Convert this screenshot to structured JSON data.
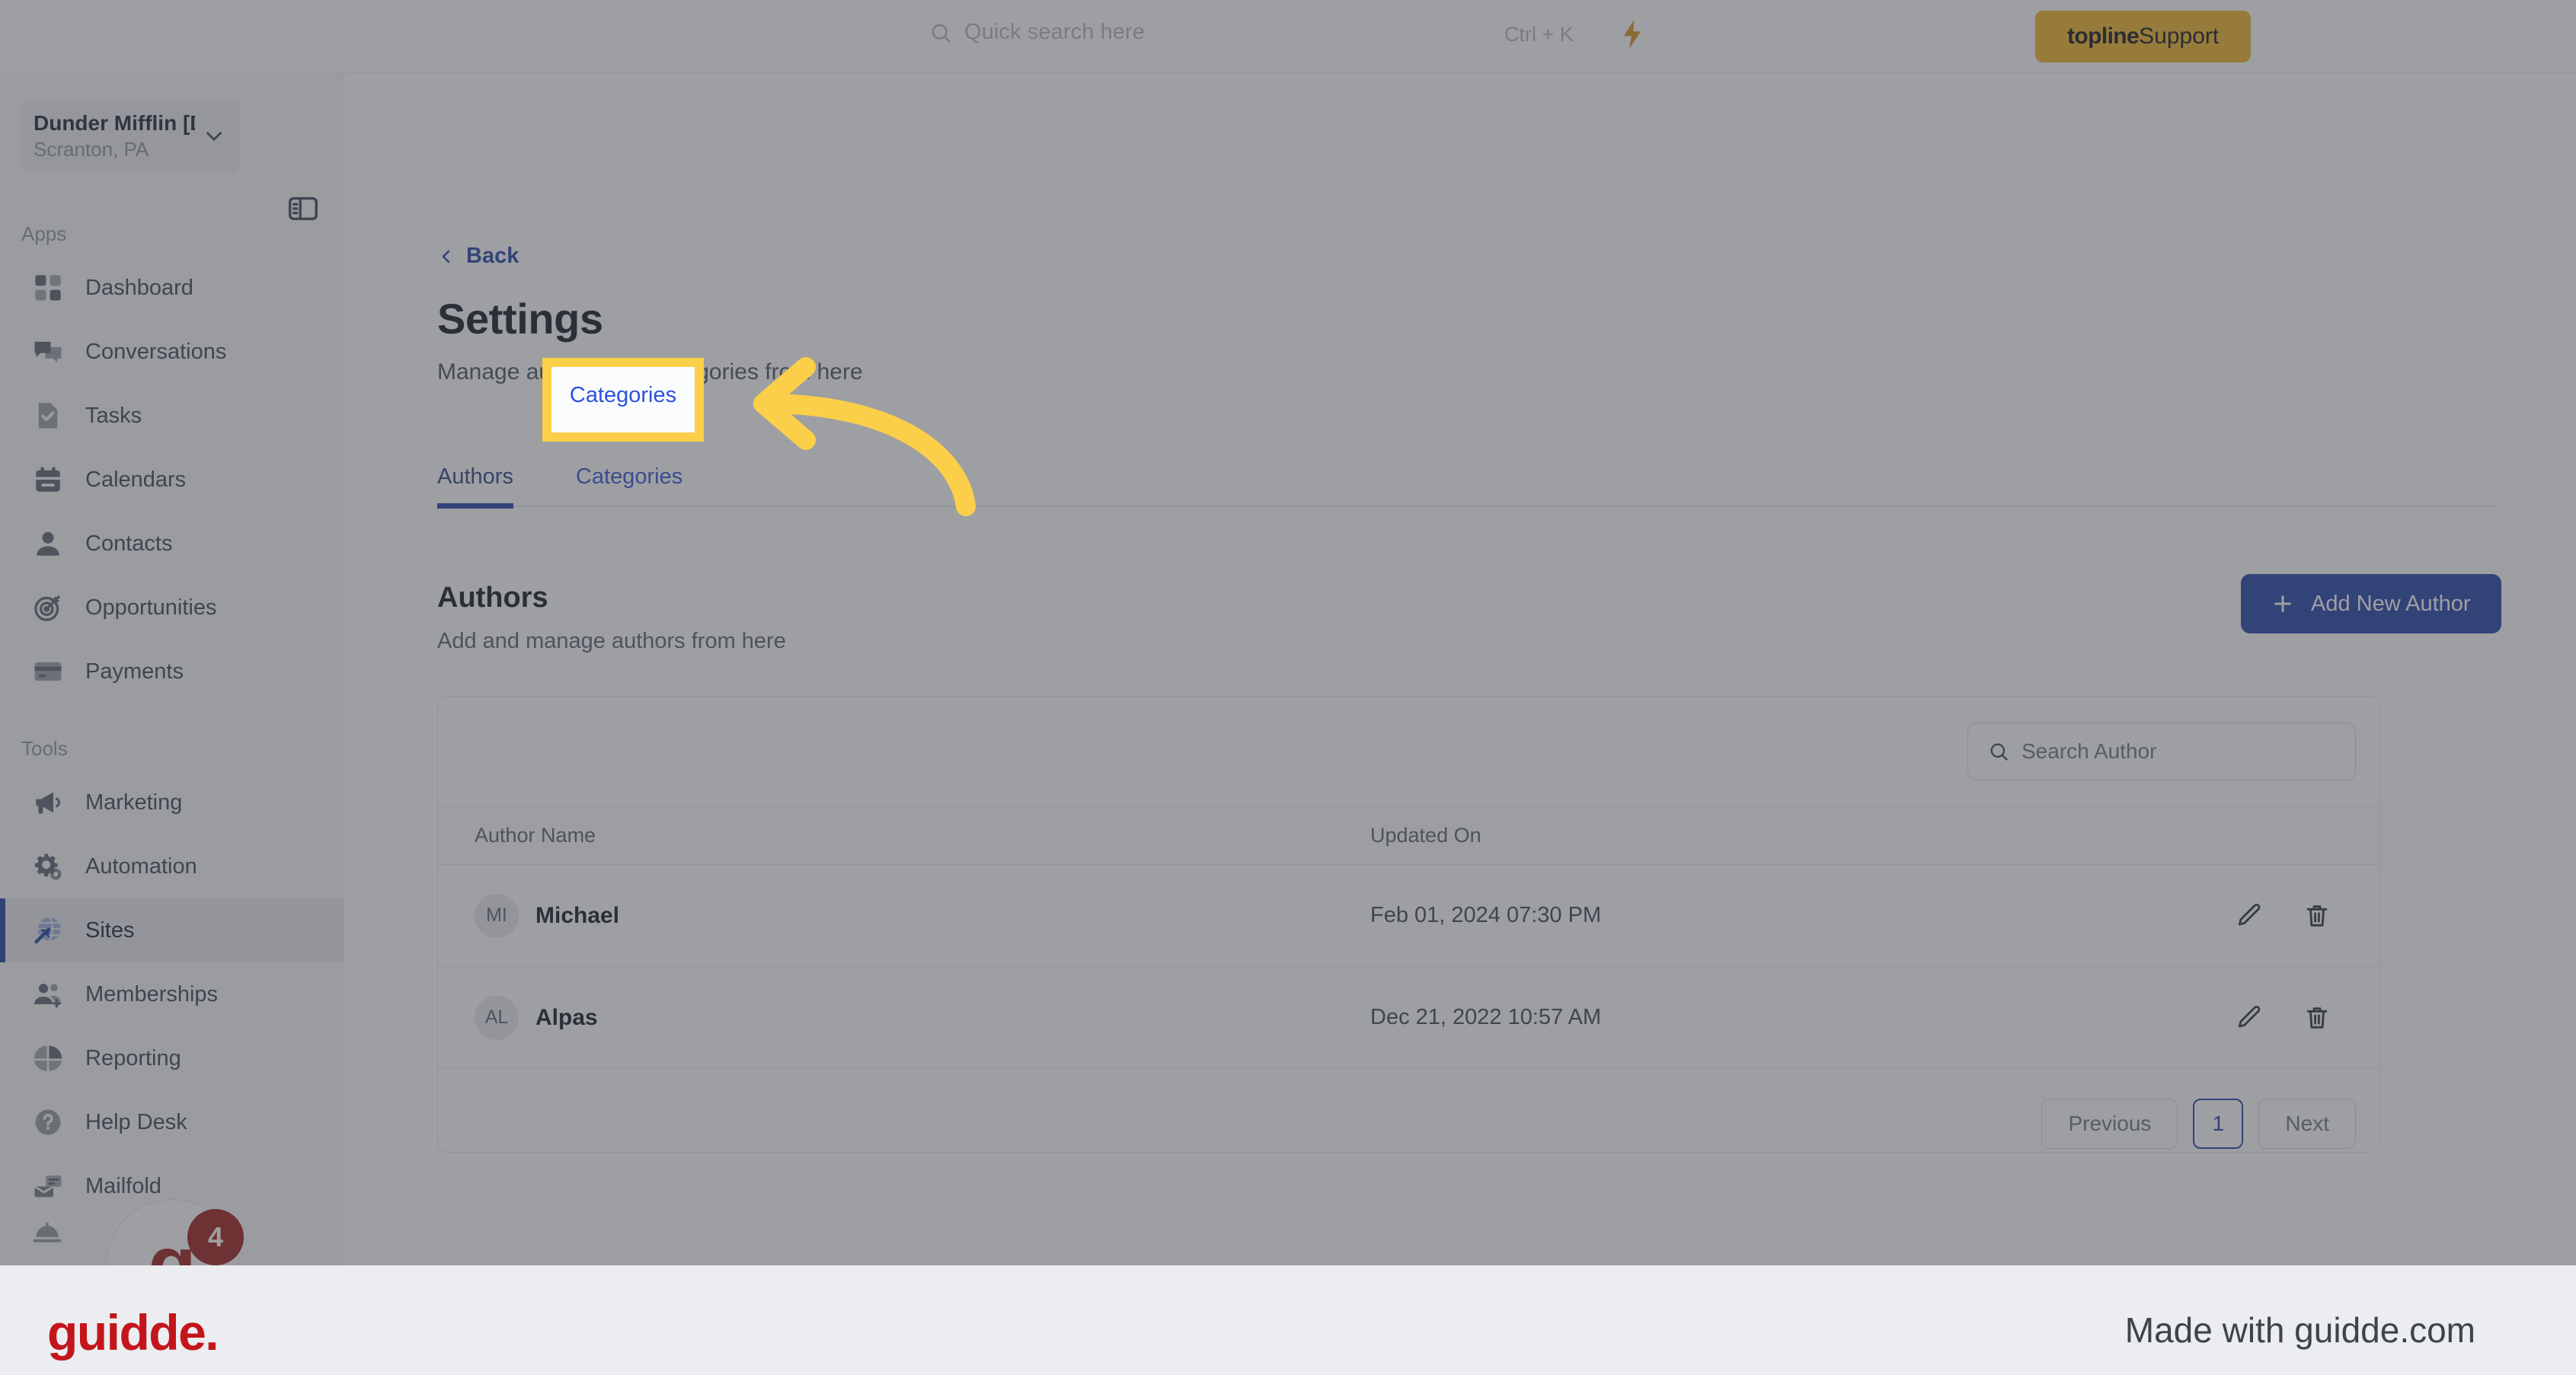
{
  "topbar": {
    "search_placeholder": "Quick search here",
    "search_shortcut": "Ctrl + K",
    "bolt_icon": "lightning-bolt-icon",
    "search_icon": "search-icon",
    "support_brand": "topline",
    "support_word": " Support",
    "support_bg": "#f0b429"
  },
  "sidebar": {
    "org_name": "Dunder Mifflin [D...",
    "org_location": "Scranton, PA",
    "chevron_icon": "chevron-down-icon",
    "panel_toggle_icon": "sidebar-toggle-icon",
    "bell_icon": "service-bell-icon",
    "sections": [
      {
        "label": "Apps",
        "items": [
          {
            "label": "Dashboard",
            "icon": "dashboard-icon",
            "active": false
          },
          {
            "label": "Conversations",
            "icon": "chat-bubbles-icon",
            "active": false
          },
          {
            "label": "Tasks",
            "icon": "task-check-icon",
            "active": false
          },
          {
            "label": "Calendars",
            "icon": "calendar-icon",
            "active": false
          },
          {
            "label": "Contacts",
            "icon": "person-icon",
            "active": false
          },
          {
            "label": "Opportunities",
            "icon": "target-icon",
            "active": false
          },
          {
            "label": "Payments",
            "icon": "credit-card-icon",
            "active": false
          }
        ]
      },
      {
        "label": "Tools",
        "items": [
          {
            "label": "Marketing",
            "icon": "megaphone-icon",
            "active": false
          },
          {
            "label": "Automation",
            "icon": "gears-icon",
            "active": false
          },
          {
            "label": "Sites",
            "icon": "globe-arrow-icon",
            "active": true
          },
          {
            "label": "Memberships",
            "icon": "people-add-icon",
            "active": false
          },
          {
            "label": "Reporting",
            "icon": "pie-chart-icon",
            "active": false
          },
          {
            "label": "Help Desk",
            "icon": "question-icon",
            "active": false
          },
          {
            "label": "Mailfold",
            "icon": "mail-tray-icon",
            "active": false
          }
        ]
      }
    ],
    "active_accent": "#1f3fa8"
  },
  "main": {
    "back_label": "Back",
    "back_icon": "chevron-left-icon",
    "title": "Settings",
    "subtitle": "Manage authors and categories from here",
    "tabs": [
      {
        "label": "Authors",
        "active": true
      },
      {
        "label": "Categories",
        "active": false
      }
    ],
    "section": {
      "title": "Authors",
      "subtitle": "Add and manage authors from here"
    },
    "add_button": {
      "label": "Add New Author",
      "icon": "plus-icon",
      "bg": "#1f3fa8"
    },
    "search": {
      "placeholder": "Search Author",
      "icon": "search-icon"
    },
    "table": {
      "columns": [
        "Author Name",
        "Updated On",
        ""
      ],
      "rows": [
        {
          "initials": "MI",
          "name": "Michael",
          "updated_on": "Feb 01, 2024 07:30 PM",
          "edit_icon": "pencil-icon",
          "delete_icon": "trash-icon"
        },
        {
          "initials": "AL",
          "name": "Alpas",
          "updated_on": "Dec 21, 2022 10:57 AM",
          "edit_icon": "pencil-icon",
          "delete_icon": "trash-icon"
        }
      ]
    },
    "pagination": {
      "previous_label": "Previous",
      "current_page": "1",
      "next_label": "Next"
    }
  },
  "widget": {
    "logo_letter": "g",
    "badge_count": "4",
    "badge_color": "#9c1a1a"
  },
  "highlight": {
    "target_label": "Categories",
    "color": "#fbcf4a",
    "arrow_icon": "curved-arrow-left-icon"
  },
  "footer": {
    "logo": "guidde.",
    "made_with": "Made with guidde.com",
    "logo_color": "#c4151c"
  }
}
